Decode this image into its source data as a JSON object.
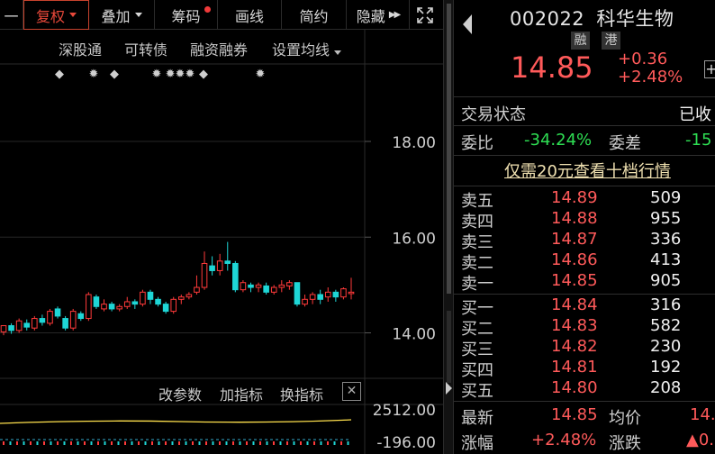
{
  "toolbar": {
    "items": [
      {
        "label": "一",
        "caret": false
      },
      {
        "label": "复权",
        "caret": true
      },
      {
        "label": "叠加",
        "caret": true
      },
      {
        "label": "筹码",
        "caret": false
      },
      {
        "label": "画线",
        "caret": false
      },
      {
        "label": "简约",
        "caret": false
      },
      {
        "label": "隐藏",
        "caret": false
      }
    ],
    "hide_arrows": "▶▶",
    "fullscreen_icon": "expand-icon"
  },
  "subbar": {
    "items": [
      "深股通",
      "可转债",
      "融资融券",
      "设置均线"
    ]
  },
  "chart": {
    "y_ticks": [
      "18.00",
      "16.00",
      "14.00"
    ],
    "y_tick_values": [
      18,
      16,
      14
    ],
    "ymin": 13.2,
    "ymax": 19.6,
    "up_color": "#ff3a3a",
    "down_color": "#1ed6d6",
    "candles": [
      [
        14.02,
        14.15,
        13.95,
        14.1
      ],
      [
        14.15,
        14.05,
        13.98,
        14.2
      ],
      [
        14.05,
        14.25,
        14.0,
        14.3
      ],
      [
        14.2,
        14.12,
        14.05,
        14.28
      ],
      [
        14.1,
        14.3,
        14.05,
        14.35
      ],
      [
        14.3,
        14.22,
        14.15,
        14.38
      ],
      [
        14.2,
        14.45,
        14.15,
        14.5
      ],
      [
        14.5,
        14.35,
        14.3,
        14.55
      ],
      [
        14.3,
        14.1,
        14.05,
        14.35
      ],
      [
        14.1,
        14.45,
        14.05,
        14.5
      ],
      [
        14.4,
        14.3,
        14.25,
        14.45
      ],
      [
        14.3,
        14.8,
        14.25,
        14.85
      ],
      [
        14.75,
        14.55,
        14.5,
        14.8
      ],
      [
        14.5,
        14.6,
        14.45,
        14.7
      ],
      [
        14.6,
        14.5,
        14.45,
        14.65
      ],
      [
        14.5,
        14.55,
        14.45,
        14.6
      ],
      [
        14.55,
        14.65,
        14.5,
        14.75
      ],
      [
        14.65,
        14.6,
        14.5,
        14.7
      ],
      [
        14.6,
        14.85,
        14.55,
        14.9
      ],
      [
        14.85,
        14.7,
        14.6,
        14.9
      ],
      [
        14.7,
        14.6,
        14.55,
        14.75
      ],
      [
        14.6,
        14.45,
        14.4,
        14.65
      ],
      [
        14.45,
        14.7,
        14.4,
        14.75
      ],
      [
        14.7,
        14.75,
        14.6,
        14.8
      ],
      [
        14.75,
        14.8,
        14.7,
        14.85
      ],
      [
        14.85,
        14.95,
        14.8,
        15.2
      ],
      [
        14.95,
        15.45,
        14.9,
        15.7
      ],
      [
        15.4,
        15.3,
        15.2,
        15.6
      ],
      [
        15.3,
        15.5,
        15.2,
        15.65
      ],
      [
        15.5,
        15.45,
        15.3,
        15.9
      ],
      [
        15.45,
        14.9,
        14.85,
        15.5
      ],
      [
        14.9,
        15.05,
        14.85,
        15.1
      ],
      [
        15.0,
        14.95,
        14.85,
        15.05
      ],
      [
        14.95,
        15.0,
        14.85,
        15.05
      ],
      [
        14.98,
        14.85,
        14.8,
        15.05
      ],
      [
        14.85,
        14.95,
        14.8,
        15.0
      ],
      [
        14.95,
        15.0,
        14.85,
        15.1
      ],
      [
        14.98,
        15.05,
        14.9,
        15.1
      ],
      [
        15.05,
        14.6,
        14.55,
        15.05
      ],
      [
        14.6,
        14.7,
        14.55,
        14.8
      ],
      [
        14.7,
        14.8,
        14.6,
        14.85
      ],
      [
        14.8,
        14.7,
        14.6,
        14.9
      ],
      [
        14.75,
        14.85,
        14.65,
        14.95
      ],
      [
        14.85,
        14.75,
        14.65,
        14.9
      ],
      [
        14.75,
        14.92,
        14.7,
        14.95
      ],
      [
        14.82,
        14.85,
        14.7,
        15.15
      ]
    ],
    "event_markers": [
      "◆",
      "✹",
      "◆",
      "✹",
      "✹✹✹",
      "◆",
      "✹"
    ],
    "indicator_bar": {
      "items": [
        "改参数",
        "加指标",
        "换指标"
      ],
      "close_icon": "close-icon",
      "close_glyph": "✕"
    },
    "volume_ticks": [
      "2512.00",
      "-196.00"
    ]
  },
  "quote": {
    "code": "002022",
    "name": "科华生物",
    "tags": [
      "融",
      "港"
    ],
    "price": "14.85",
    "change": "+0.36",
    "change_pct": "+2.48%",
    "expand_glyph": "+",
    "trade_status_label": "交易状态",
    "trade_status_value": "已收",
    "weibi_label": "委比",
    "weibi_value": "-34.24%",
    "weicha_label": "委差",
    "weicha_value": "-15",
    "promo": "仅需20元查看十档行情",
    "asks": [
      {
        "label": "卖五",
        "price": "14.89",
        "vol": "509"
      },
      {
        "label": "卖四",
        "price": "14.88",
        "vol": "955"
      },
      {
        "label": "卖三",
        "price": "14.87",
        "vol": "336"
      },
      {
        "label": "卖二",
        "price": "14.86",
        "vol": "413"
      },
      {
        "label": "卖一",
        "price": "14.85",
        "vol": "905"
      }
    ],
    "bids": [
      {
        "label": "买一",
        "price": "14.84",
        "vol": "316"
      },
      {
        "label": "买二",
        "price": "14.83",
        "vol": "582"
      },
      {
        "label": "买三",
        "price": "14.82",
        "vol": "230"
      },
      {
        "label": "买四",
        "price": "14.81",
        "vol": "192"
      },
      {
        "label": "买五",
        "price": "14.80",
        "vol": "208"
      }
    ],
    "latest_label": "最新",
    "latest_value": "14.85",
    "avg_label": "均价",
    "avg_value": "14.",
    "pct_label": "涨幅",
    "pct_value": "+2.48%",
    "diff_label": "涨跌",
    "diff_value": "▲0."
  }
}
